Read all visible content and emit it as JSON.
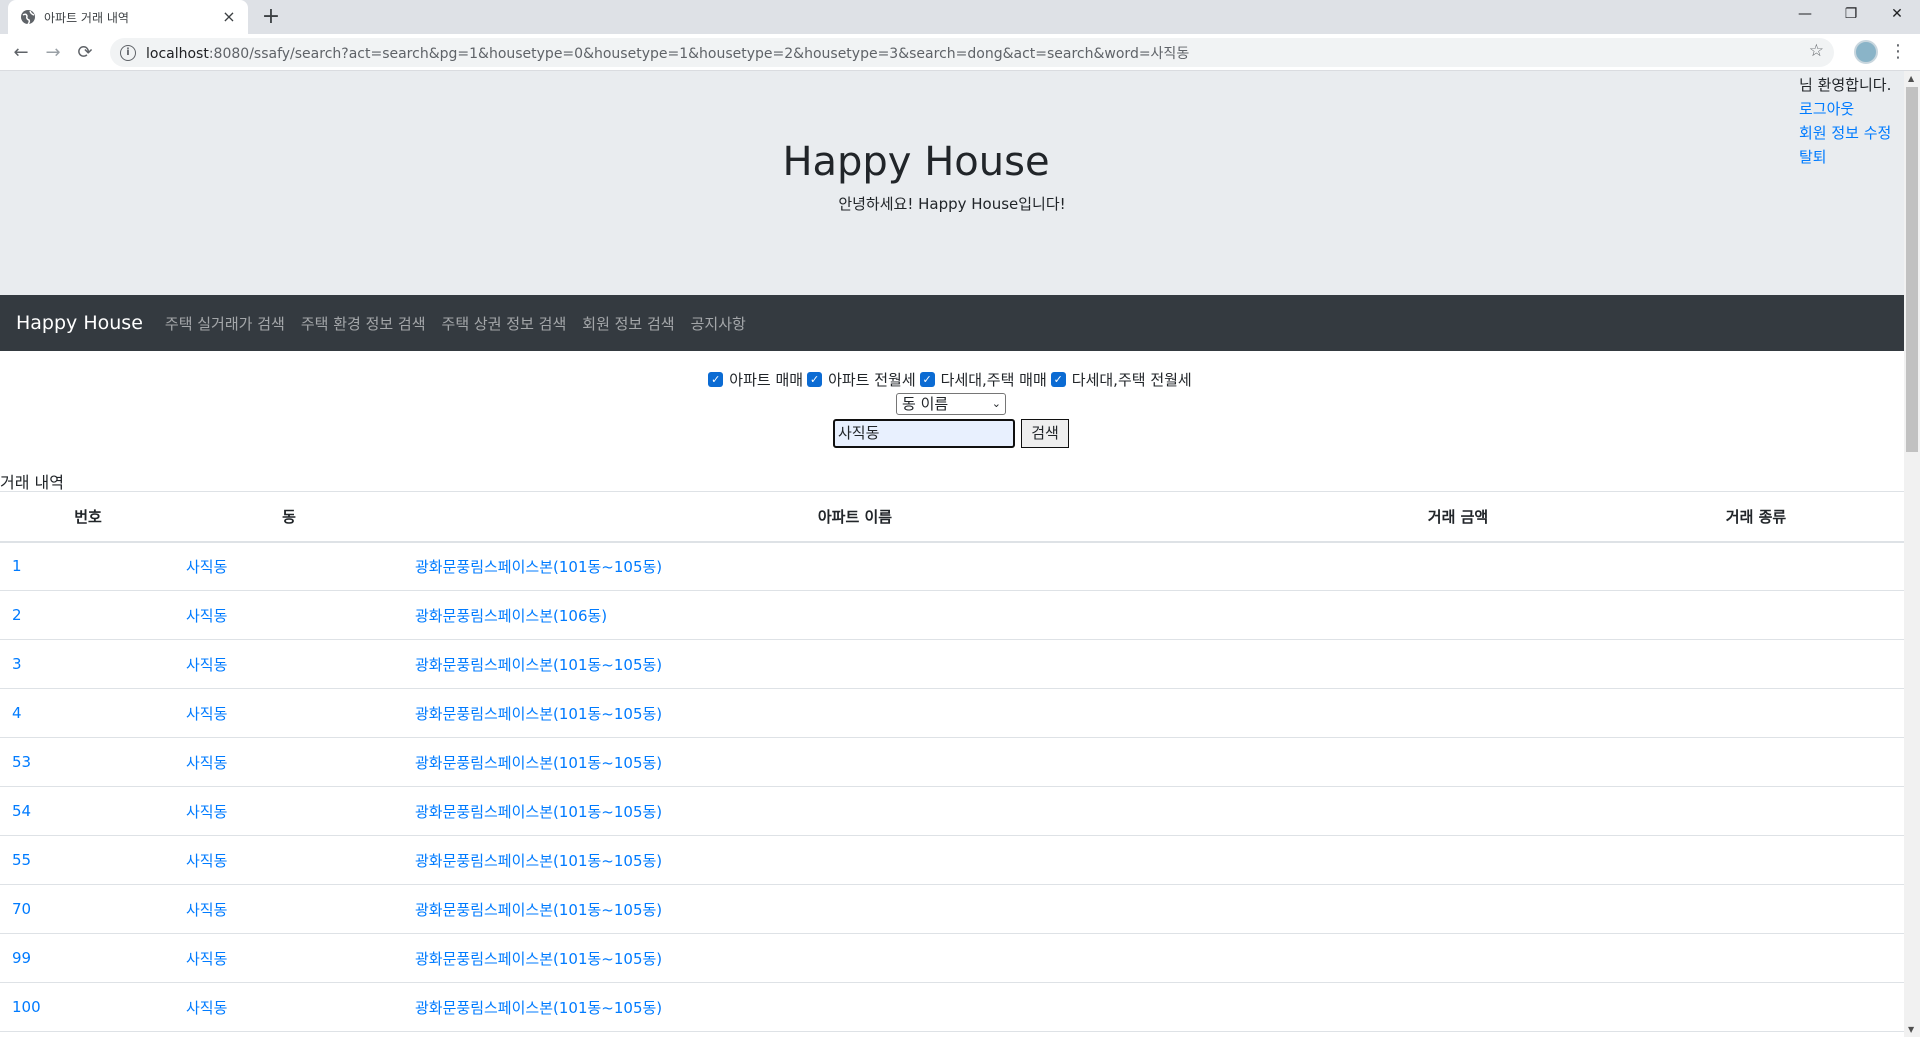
{
  "browser": {
    "tab_title": "아파트 거래 내역",
    "tab_close": "×",
    "new_tab": "+",
    "url_host": "localhost",
    "url_rest": ":8080/ssafy/search?act=search&pg=1&housetype=0&housetype=1&housetype=2&housetype=3&search=dong&act=search&word=사직동",
    "window_controls": [
      "—",
      "❐",
      "✕"
    ]
  },
  "header": {
    "title": "Happy House",
    "subtitle": "안녕하세요! Happy House입니다!"
  },
  "user": {
    "welcome": "님 환영합니다.",
    "logout": "로그아웃",
    "edit_profile": "회원 정보 수정",
    "withdraw": "탈퇴"
  },
  "navbar": {
    "brand": "Happy House",
    "links": [
      "주택 실거래가 검색",
      "주택 환경 정보 검색",
      "주택 상권 정보 검색",
      "회원 정보 검색",
      "공지사항"
    ]
  },
  "filters": {
    "options": [
      {
        "label": "아파트 매매",
        "checked": true
      },
      {
        "label": "아파트 전월세",
        "checked": true
      },
      {
        "label": "다세대,주택 매매",
        "checked": true
      },
      {
        "label": "다세대,주택 전월세",
        "checked": true
      }
    ],
    "search_type": "동 이름",
    "search_word": "사직동",
    "search_button": "검색"
  },
  "table": {
    "caption": "거래 내역",
    "headers": [
      "번호",
      "동",
      "아파트 이름",
      "거래 금액",
      "거래 종류"
    ],
    "rows": [
      {
        "no": "1",
        "dong": "사직동",
        "apt": "광화문풍림스페이스본(101동~105동)",
        "price": "",
        "type": ""
      },
      {
        "no": "2",
        "dong": "사직동",
        "apt": "광화문풍림스페이스본(106동)",
        "price": "",
        "type": ""
      },
      {
        "no": "3",
        "dong": "사직동",
        "apt": "광화문풍림스페이스본(101동~105동)",
        "price": "",
        "type": ""
      },
      {
        "no": "4",
        "dong": "사직동",
        "apt": "광화문풍림스페이스본(101동~105동)",
        "price": "",
        "type": ""
      },
      {
        "no": "53",
        "dong": "사직동",
        "apt": "광화문풍림스페이스본(101동~105동)",
        "price": "",
        "type": ""
      },
      {
        "no": "54",
        "dong": "사직동",
        "apt": "광화문풍림스페이스본(101동~105동)",
        "price": "",
        "type": ""
      },
      {
        "no": "55",
        "dong": "사직동",
        "apt": "광화문풍림스페이스본(101동~105동)",
        "price": "",
        "type": ""
      },
      {
        "no": "70",
        "dong": "사직동",
        "apt": "광화문풍림스페이스본(101동~105동)",
        "price": "",
        "type": ""
      },
      {
        "no": "99",
        "dong": "사직동",
        "apt": "광화문풍림스페이스본(101동~105동)",
        "price": "",
        "type": ""
      },
      {
        "no": "100",
        "dong": "사직동",
        "apt": "광화문풍림스페이스본(101동~105동)",
        "price": "",
        "type": ""
      }
    ]
  },
  "colors": {
    "link": "#007bff",
    "navbar": "#343a40",
    "jumbotron": "#e9ecef",
    "checkbox": "#0b6bd3"
  }
}
